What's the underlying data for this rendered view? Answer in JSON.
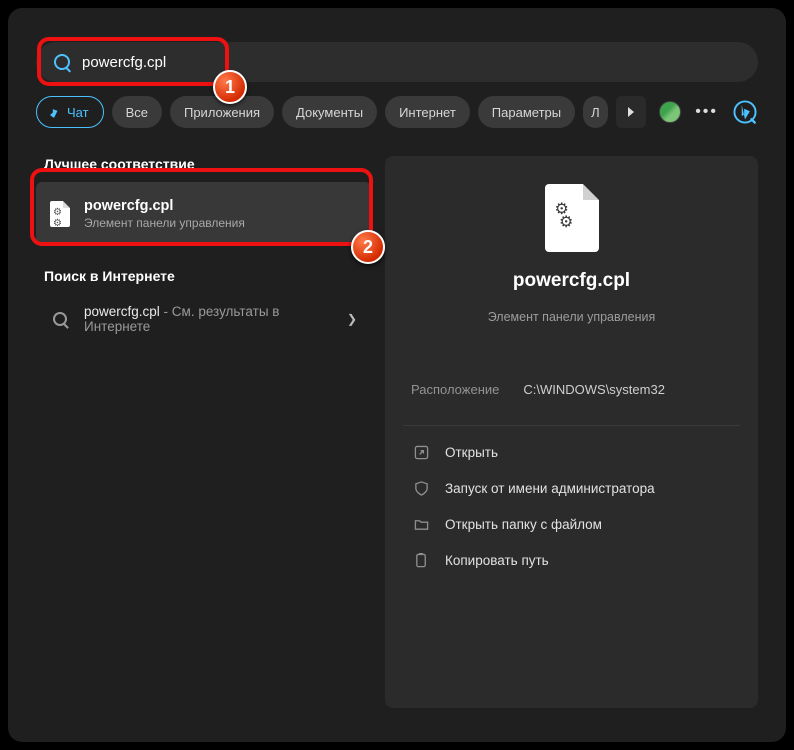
{
  "search": {
    "query": "powercfg.cpl"
  },
  "chips": {
    "chat": "Чат",
    "all": "Все",
    "apps": "Приложения",
    "docs": "Документы",
    "internet": "Интернет",
    "params": "Параметры",
    "partial": "Л"
  },
  "left": {
    "best_match_header": "Лучшее соответствие",
    "best_result": {
      "title": "powercfg.cpl",
      "subtitle": "Элемент панели управления"
    },
    "web_search_header": "Поиск в Интернете",
    "web_result": {
      "title": "powercfg.cpl",
      "suffix": " - См. результаты в Интернете"
    }
  },
  "preview": {
    "title": "powercfg.cpl",
    "subtitle": "Элемент панели управления",
    "location_label": "Расположение",
    "location_value": "C:\\WINDOWS\\system32",
    "actions": {
      "open": "Открыть",
      "admin": "Запуск от имени администратора",
      "folder": "Открыть папку с файлом",
      "copy": "Копировать путь"
    }
  },
  "annotations": {
    "b1": "1",
    "b2": "2"
  }
}
